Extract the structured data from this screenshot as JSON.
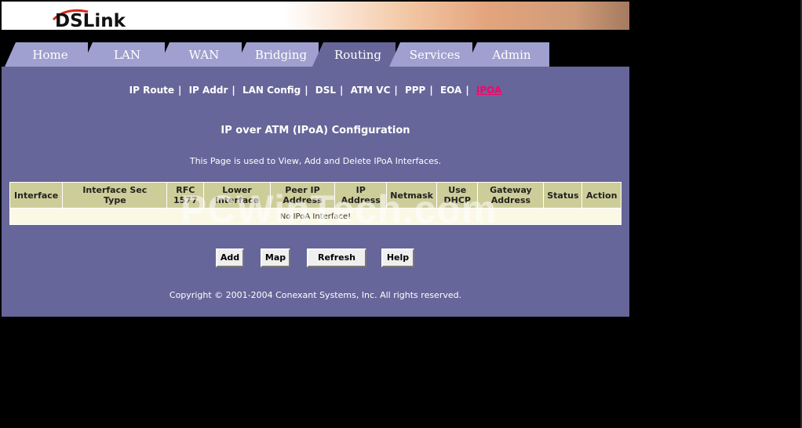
{
  "brand": {
    "logo_text": "DSLink"
  },
  "tabs": [
    {
      "label": "Home",
      "active": false
    },
    {
      "label": "LAN",
      "active": false
    },
    {
      "label": "WAN",
      "active": false
    },
    {
      "label": "Bridging",
      "active": false
    },
    {
      "label": "Routing",
      "active": true
    },
    {
      "label": "Services",
      "active": false
    },
    {
      "label": "Admin",
      "active": false
    }
  ],
  "subnav": [
    {
      "label": "IP Route",
      "active": false
    },
    {
      "label": "IP Addr",
      "active": false
    },
    {
      "label": "LAN Config",
      "active": false
    },
    {
      "label": "DSL",
      "active": false
    },
    {
      "label": "ATM VC",
      "active": false
    },
    {
      "label": "PPP",
      "active": false
    },
    {
      "label": "EOA",
      "active": false
    },
    {
      "label": "IPOA",
      "active": true
    }
  ],
  "page": {
    "title": "IP over ATM (IPoA) Configuration",
    "description": "This Page is used to View, Add and Delete IPoA Interfaces."
  },
  "table": {
    "columns": [
      [
        "Interface"
      ],
      [
        "Interface Sec",
        "Type"
      ],
      [
        "RFC",
        "1577"
      ],
      [
        "Lower",
        "Interface"
      ],
      [
        "Peer IP",
        "Address"
      ],
      [
        "IP",
        "Address"
      ],
      [
        "Netmask"
      ],
      [
        "Use",
        "DHCP"
      ],
      [
        "Gateway",
        "Address"
      ],
      [
        "Status"
      ],
      [
        "Action"
      ]
    ],
    "empty_message": "No IPoA Interface!"
  },
  "watermark": "PCWinTech.com",
  "buttons": {
    "add": "Add",
    "map": "Map",
    "refresh": "Refresh",
    "help": "Help"
  },
  "footer": {
    "copyright": "Copyright © 2001-2004 Conexant Systems, Inc. All rights reserved."
  }
}
